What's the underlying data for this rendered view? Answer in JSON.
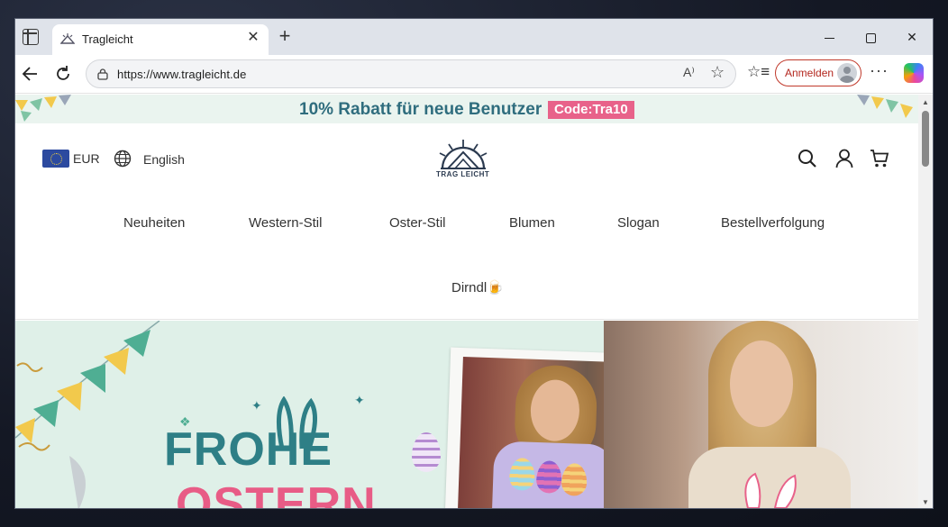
{
  "browser": {
    "tab_title": "Tragleicht",
    "url": "https://www.tragleicht.de",
    "signin_label": "Anmelden",
    "new_tab_symbol": "+",
    "close_symbol": "✕",
    "more_symbol": "···"
  },
  "promo": {
    "text": "10% Rabatt für neue Benutzer",
    "code": "Code:Tra10"
  },
  "header": {
    "currency": "EUR",
    "language": "English",
    "logo_text": "TRAG LEICHT"
  },
  "nav": {
    "items": [
      "Neuheiten",
      "Western-Stil",
      "Oster-Stil",
      "Blumen",
      "Slogan",
      "Bestellverfolgung",
      "Dirndl🍺"
    ]
  },
  "hero": {
    "title": "FROHE",
    "subtitle": "OSTERN"
  },
  "colors": {
    "accent": "#2f6d7e",
    "promo_code_bg": "#e8628a",
    "signin_border": "#c0392b"
  }
}
